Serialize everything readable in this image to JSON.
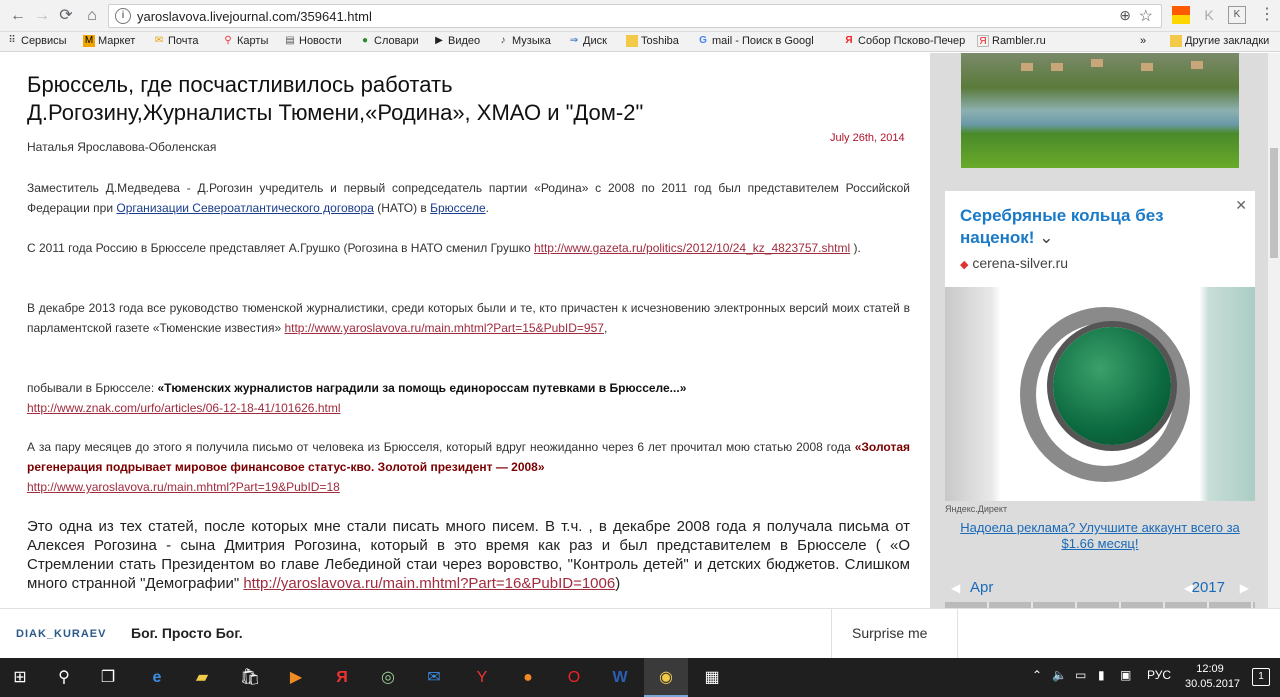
{
  "browser": {
    "url": "yaroslavova.livejournal.com/359641.html",
    "bookmarks": [
      {
        "label": "Сервисы",
        "icon": "apps-icon"
      },
      {
        "label": "Маркет",
        "icon": "market-icon"
      },
      {
        "label": "Почта",
        "icon": "mail-icon"
      },
      {
        "label": "Карты",
        "icon": "map-pin-icon"
      },
      {
        "label": "Новости",
        "icon": "news-icon"
      },
      {
        "label": "Словари",
        "icon": "dictionary-icon"
      },
      {
        "label": "Видео",
        "icon": "video-icon"
      },
      {
        "label": "Музыка",
        "icon": "music-icon"
      },
      {
        "label": "Диск",
        "icon": "disk-icon"
      },
      {
        "label": "Toshiba",
        "icon": "folder-icon"
      },
      {
        "label": "mail - Поиск в Googl",
        "icon": "google-icon"
      },
      {
        "label": "Собор Псково-Печер",
        "icon": "yandex-icon"
      },
      {
        "label": "Rambler.ru",
        "icon": "rambler-icon"
      }
    ],
    "more_label": "»",
    "other_bookmarks": "Другие закладки"
  },
  "article": {
    "title_line1": "Брюссель, где посчастливилось работать",
    "title_line2": "Д.Рогозину,Журналисты Тюмени,«Родина», ХМАО и \"Дом-2\"",
    "date": "July 26th, 2014",
    "author": "Наталья  Ярославова-Оболенская",
    "p1_text": "Заместитель  Д.Медведева    - Д.Рогозин  учредитель и первый  сопредседатель  партии   «Родина»   с  2008 по  2011   год   был представителем   Российской Федерации при ",
    "p1_link1": "Организации Североатлантического договора",
    "p1_mid": " (НАТО) в ",
    "p1_link2": "Брюсселе",
    "p1_end": ".",
    "p2_text": "С 2011  года  Россию в  Брюсселе  представляет  А.Грушко  (Рогозина  в  НАТО сменил   Грушко ",
    "p2_link": "http://www.gazeta.ru/politics/2012/10/24_kz_4823757.shtml",
    "p2_end": " ).",
    "p3_text": "В декабре 2013 года    все руководство  тюменской    журналистики, среди которых были   и те,     кто  причастен   к исчезновению электронных   версий     моих статей  в   парламентской   газете     «Тюменские   известия»   ",
    "p3_link": "http://www.yaroslavova.ru/main.mhtml?Part=15&PubID=957",
    "p3_end": ",",
    "p4_text": "побывали  в       Брюсселе:     ",
    "p4_bold": "«Тюменских  журналистов  наградили  за  помощь  единороссам  путевками  в  Брюсселе...»",
    "p4_link": "http://www.znak.com/urfo/articles/06-12-18-41/101626.html",
    "p5_text": "А   за пару  месяцев    до этого  я получила письмо от человека  из Брюсселя, который    вдруг неожиданно  через 6    лет прочитал   мою статью  2008  года  ",
    "p5_bold": "«Золотая  регенерация  подрывает  мировое  финансовое  статус-кво.    Золотой  президент  —  2008»",
    "p5_link": "http://www.yaroslavova.ru/main.mhtml?Part=19&PubID=18",
    "p6_text": "Это   одна из тех статей,   после  которых  мне  стали  писать     много  писем. В   т.ч. ,  в декабре   2008 года  я получала  письма от Алексея Рогозина   -    сына  Дмитрия  Рогозина, который в  это время  как  раз и был представителем в  Брюсселе ( «О Стремлении стать Президентом во главе Лебединой стаи через воровство, \"Контроль детей\" и детских бюджетов. Слишком много странной \"Демографии\" ",
    "p6_link": "http://yaroslavova.ru/main.mhtml?Part=16&PubID=1006",
    "p6_end": ")"
  },
  "sidebar": {
    "ad_title": "Серебряные кольца без наценок!",
    "ad_domain": "cerena-silver.ru",
    "ad_source": "Яндекс.Директ",
    "ad_upgrade": "Надоела реклама? Улучшите аккаунт всего за $1.66 месяц!",
    "cal_month": "Apr",
    "cal_year": "2017"
  },
  "bottombar": {
    "user": "DIAK_KURAEV",
    "post_title": "Бог. Просто Бог.",
    "surprise": "Surprise me"
  },
  "taskbar": {
    "lang": "РУС",
    "time": "12:09",
    "date": "30.05.2017",
    "notifications": "1"
  }
}
